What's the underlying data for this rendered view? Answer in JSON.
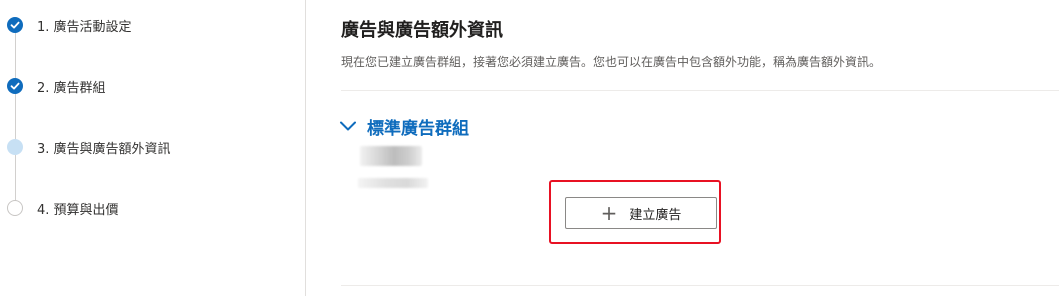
{
  "steps": [
    {
      "label": "1. 廣告活動設定",
      "state": "done"
    },
    {
      "label": "2. 廣告群組",
      "state": "done"
    },
    {
      "label": "3. 廣告與廣告額外資訊",
      "state": "current"
    },
    {
      "label": "4. 預算與出價",
      "state": "pending"
    }
  ],
  "main": {
    "title": "廣告與廣告額外資訊",
    "description": "現在您已建立廣告群組，接著您必須建立廣告。您也可以在廣告中包含額外功能，稱為廣告額外資訊。",
    "ad_group": {
      "title": "標準廣告群組",
      "create_button_label": "建立廣告"
    }
  },
  "colors": {
    "accent": "#0f6cbd",
    "highlight": "#e81123"
  }
}
